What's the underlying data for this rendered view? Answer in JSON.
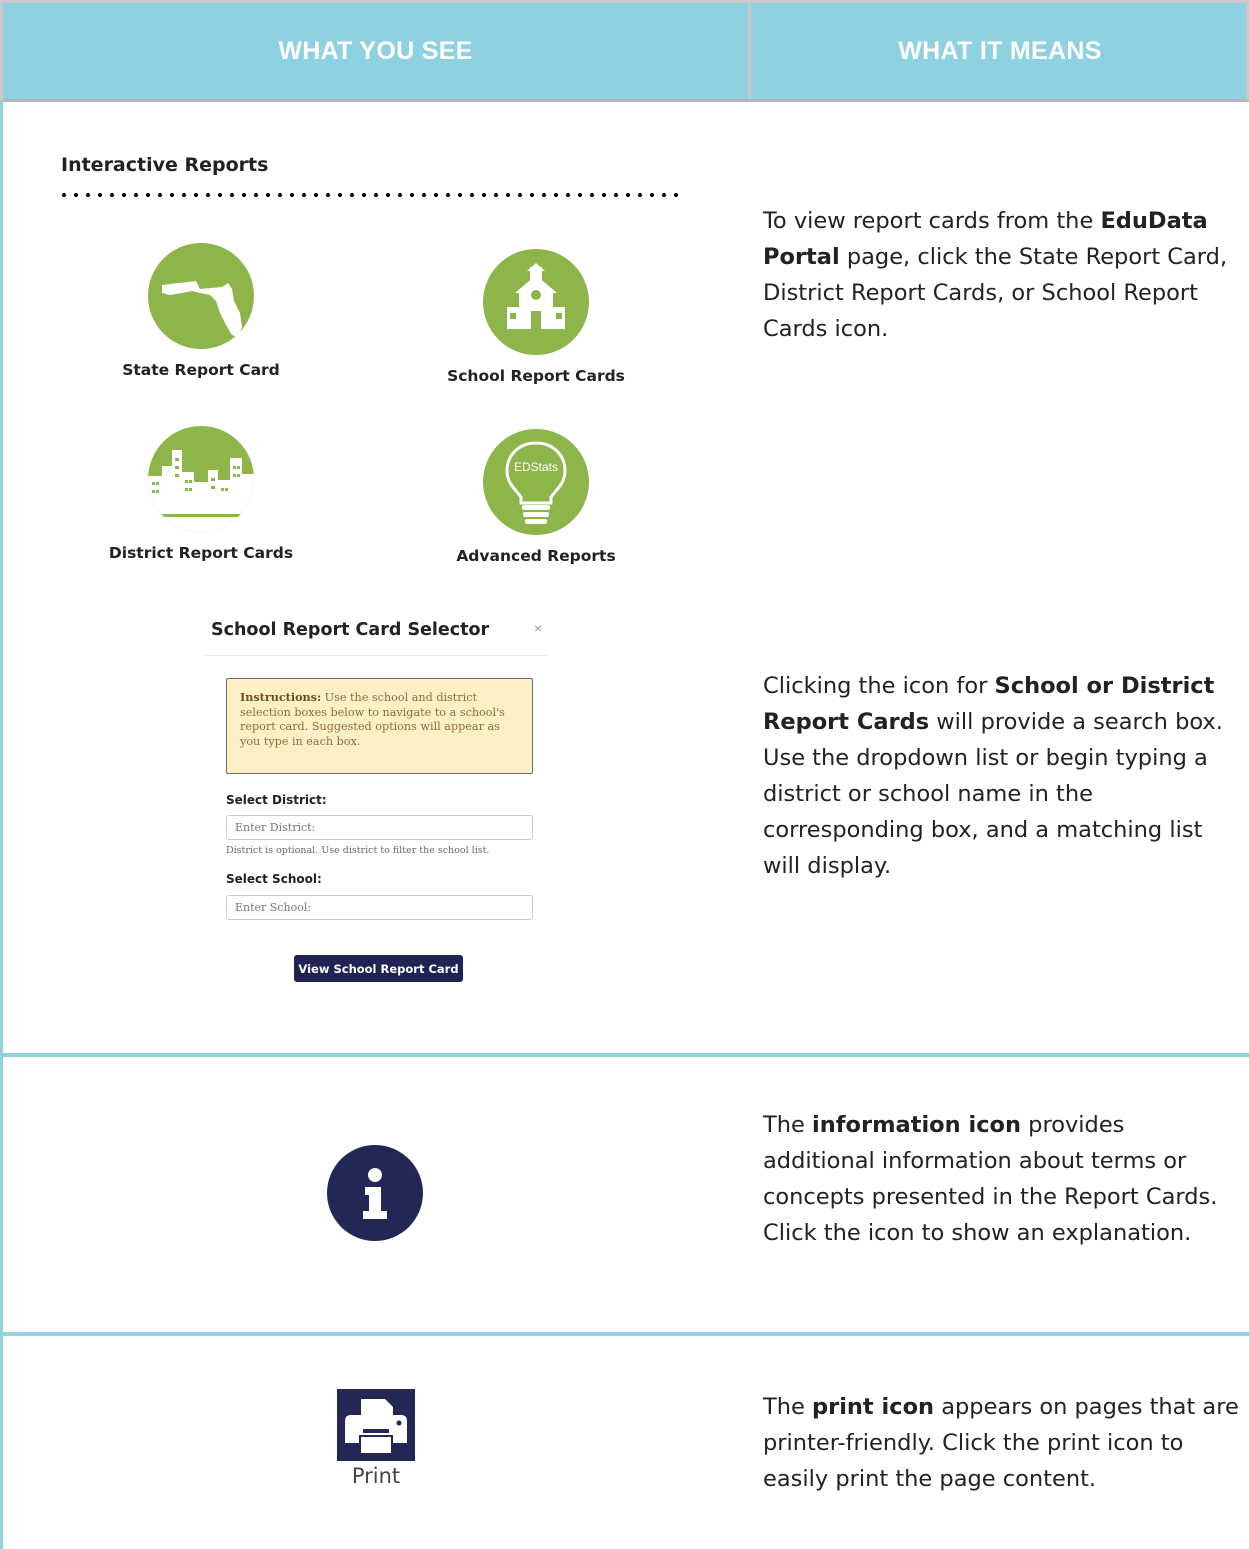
{
  "header": {
    "col_left": "WHAT YOU SEE",
    "col_right": "WHAT IT MEANS"
  },
  "row1": {
    "section_title": "Interactive Reports",
    "tiles": {
      "state": "State Report Card",
      "school": "School Report Cards",
      "district": "District Report Cards",
      "advanced": "Advanced Reports",
      "advanced_badge": "EDStats"
    },
    "desc1": {
      "p1": "To view report cards from the ",
      "b1": "EduData Portal",
      "p2": " page, click the State Report Card, District Report Cards, or School Report Cards icon."
    },
    "modal": {
      "title": "School Report Card Selector",
      "close": "×",
      "instructions_label": "Instructions:",
      "instructions_text": " Use the school and district selection boxes below to navigate to a school's report card. Suggested options will appear as you type in each box.",
      "district_label": "Select District:",
      "district_placeholder": "Enter District:",
      "district_help": "District is optional. Use district to filter the school list.",
      "school_label": "Select School:",
      "school_placeholder": "Enter School:",
      "button": "View School Report Card"
    },
    "desc2": {
      "p1": "Clicking the icon for ",
      "b1": "School or District Report Cards",
      "p2": " will provide a search box. Use the dropdown list or begin typing a district or school name in the corresponding box, and a matching list will display."
    }
  },
  "row2": {
    "desc": {
      "p1": "The ",
      "b1": "information icon",
      "p2": " provides additional information about terms or concepts presented in the Report Cards. Click the icon to show an explanation."
    }
  },
  "row3": {
    "print_label": "Print",
    "desc": {
      "p1": "The ",
      "b1": "print icon",
      "p2": " appears on pages that are printer-friendly. Click the print icon to easily print the page content."
    }
  },
  "colors": {
    "header_bg": "#8ed2e1",
    "tile_green": "#8db54a",
    "navy": "#232755",
    "instructions_bg": "#fcf0c4"
  }
}
